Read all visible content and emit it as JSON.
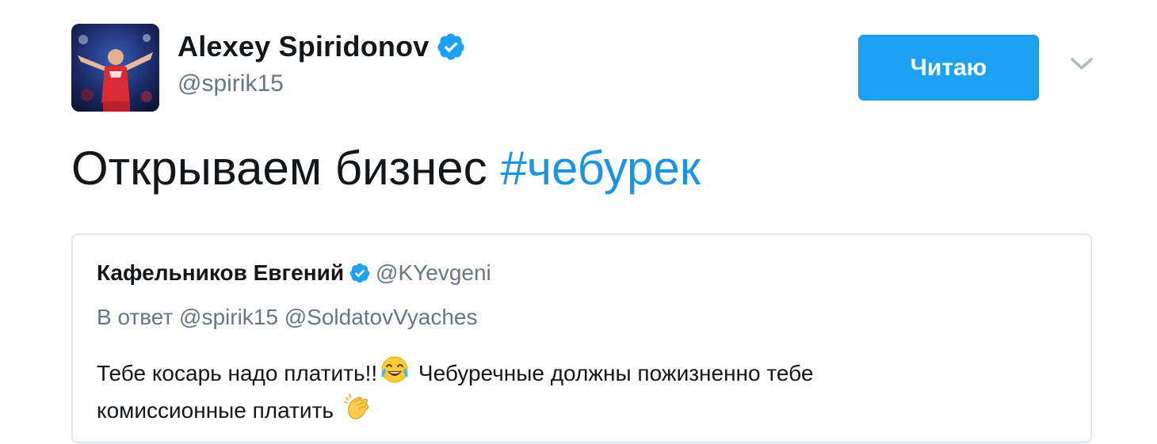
{
  "author": {
    "display_name": "Alexey Spiridonov",
    "handle": "@spirik15",
    "verified": true,
    "avatar_icon": "avatar-photo"
  },
  "follow_button": {
    "label": "Читаю",
    "color": "#1da1f2"
  },
  "menu_icon": "chevron-down-icon",
  "tweet": {
    "text": "Открываем бизнес ",
    "hashtag": "#чебурек"
  },
  "quoted_tweet": {
    "author_name": "Кафельников Евгений",
    "author_handle": "@KYevgeni",
    "verified": true,
    "reply_context": "В ответ @spirik15 @SoldatovVyaches",
    "body_part1": "Тебе косарь надо платить!!",
    "emoji1": "face-with-tears-of-joy",
    "body_part2": " Чебуречные должны пожизненно тебе",
    "body_part3": "комиссионные платить ",
    "emoji2": "clapping-hands"
  },
  "colors": {
    "link": "#1b95e0",
    "secondary_text": "#657786",
    "verified_badge": "#1da1f2",
    "border": "#e1e8ed"
  }
}
